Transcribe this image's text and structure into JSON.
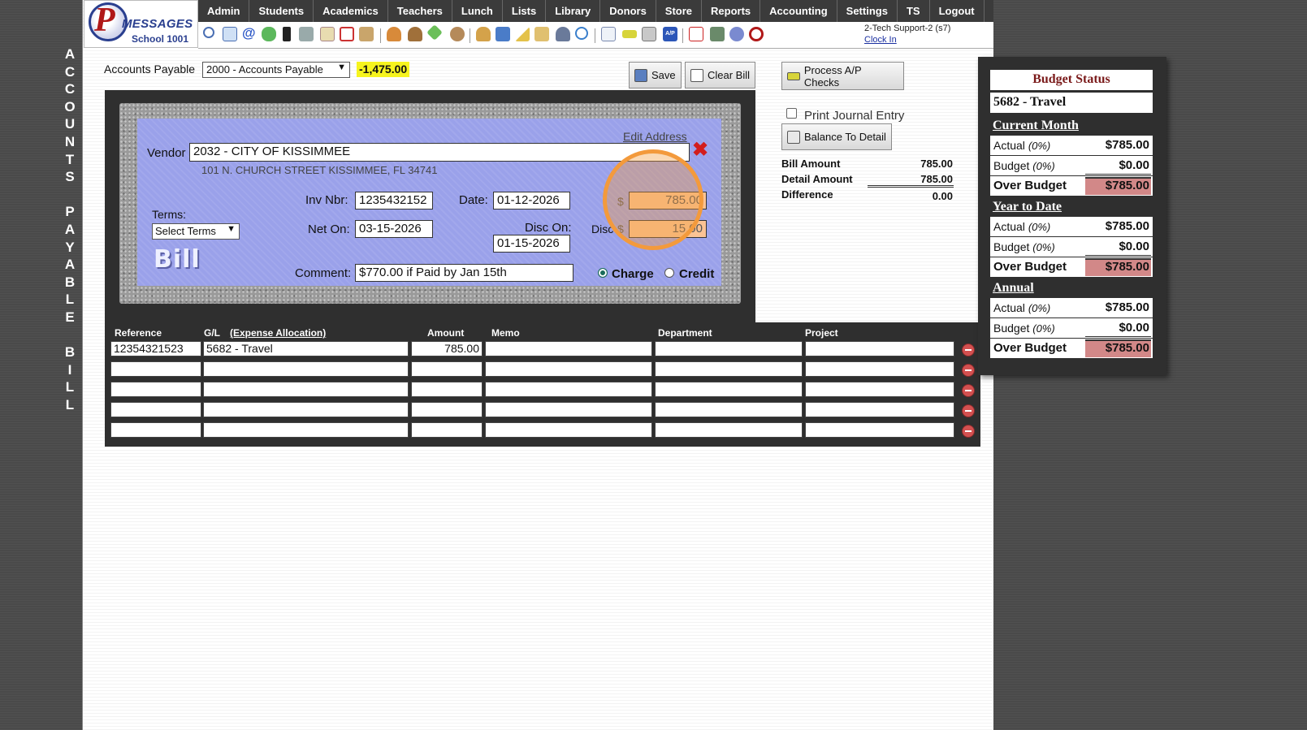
{
  "vertical_label": [
    "A",
    "C",
    "C",
    "O",
    "U",
    "N",
    "T",
    "S",
    " ",
    "P",
    "A",
    "Y",
    "A",
    "B",
    "L",
    "E",
    " ",
    "B",
    "I",
    "L",
    "L"
  ],
  "logo": {
    "letter": "P",
    "brand": "MESSAGES",
    "school": "School 1001"
  },
  "nav": [
    "Admin",
    "Students",
    "Academics",
    "Teachers",
    "Lunch",
    "Lists",
    "Library",
    "Donors",
    "Store",
    "Reports",
    "Accounting",
    "Settings",
    "TS",
    "Logout"
  ],
  "user": {
    "name": "2-Tech Support-2 (s7)",
    "clock_in": "Clock In"
  },
  "header": {
    "ap_label": "Accounts Payable",
    "ap_account": "2000 - Accounts Payable",
    "ap_balance": "-1,475.00",
    "save": "Save",
    "clear_bill": "Clear Bill",
    "process_checks": "Process A/P Checks",
    "print_journal": "Print Journal Entry",
    "balance_to_detail": "Balance To Detail"
  },
  "bill": {
    "edit_address": "Edit Address",
    "vendor_label": "Vendor",
    "vendor": "2032 - CITY OF KISSIMMEE",
    "address": "101 N. CHURCH STREET KISSIMMEE, FL 34741",
    "terms_label": "Terms:",
    "terms_value": "Select Terms",
    "inv_label": "Inv Nbr:",
    "inv_value": "1235432152",
    "date_label": "Date:",
    "date_value": "01-12-2026",
    "amount_symbol": "$",
    "amount_value": "785.00",
    "net_on_label": "Net On:",
    "net_on_value": "03-15-2026",
    "disc_on_label": "Disc On:",
    "disc_on_value": "01-15-2026",
    "disc_label": "Disc",
    "disc_symbol": "$",
    "disc_value": "15.00",
    "bill_word": "Bill",
    "comment_label": "Comment:",
    "comment_value": "$770.00 if Paid by Jan 15th",
    "charge_label": "Charge",
    "credit_label": "Credit",
    "type_selected": "Charge"
  },
  "summary": {
    "bill_amount_label": "Bill Amount",
    "bill_amount": "785.00",
    "detail_amount_label": "Detail Amount",
    "detail_amount": "785.00",
    "difference_label": "Difference",
    "difference": "0.00"
  },
  "grid": {
    "headers": {
      "reference": "Reference",
      "gl": "G/L",
      "allocation": "(Expense Allocation)",
      "amount": "Amount",
      "memo": "Memo",
      "department": "Department",
      "project": "Project"
    },
    "rows": [
      {
        "reference": "12354321523",
        "gl": "5682 - Travel",
        "amount": "785.00",
        "memo": "",
        "department": "",
        "project": ""
      },
      {
        "reference": "",
        "gl": "",
        "amount": "",
        "memo": "",
        "department": "",
        "project": ""
      },
      {
        "reference": "",
        "gl": "",
        "amount": "",
        "memo": "",
        "department": "",
        "project": ""
      },
      {
        "reference": "",
        "gl": "",
        "amount": "",
        "memo": "",
        "department": "",
        "project": ""
      },
      {
        "reference": "",
        "gl": "",
        "amount": "",
        "memo": "",
        "department": "",
        "project": ""
      }
    ]
  },
  "budget": {
    "title": "Budget Status",
    "account": "5682 - Travel",
    "sections": [
      {
        "name": "Current Month",
        "actual_label": "Actual",
        "actual_pct": "(0%)",
        "actual": "$785.00",
        "budget_label": "Budget",
        "budget_pct": "(0%)",
        "budget": "$0.00",
        "over_label": "Over Budget",
        "over": "$785.00"
      },
      {
        "name": "Year to Date",
        "actual_label": "Actual",
        "actual_pct": "(0%)",
        "actual": "$785.00",
        "budget_label": "Budget",
        "budget_pct": "(0%)",
        "budget": "$0.00",
        "over_label": "Over Budget",
        "over": "$785.00"
      },
      {
        "name": "Annual",
        "actual_label": "Actual",
        "actual_pct": "(0%)",
        "actual": "$785.00",
        "budget_label": "Budget",
        "budget_pct": "(0%)",
        "budget": "$0.00",
        "over_label": "Over Budget",
        "over": "$785.00"
      }
    ]
  },
  "colors": {
    "accent_highlight": "#f6f41e",
    "bill_panel": "#9aa1ea",
    "over_budget": "#d28888",
    "focus_ring": "#f39a3c"
  }
}
